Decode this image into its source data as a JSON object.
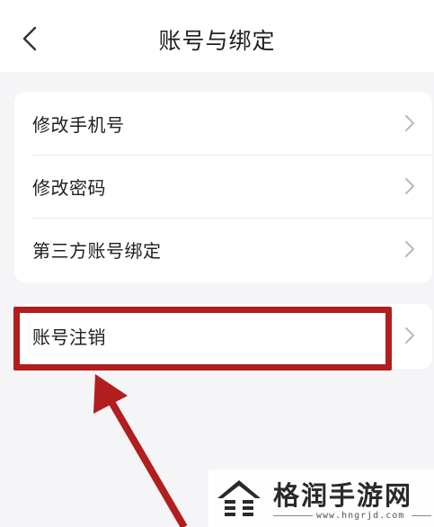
{
  "header": {
    "title": "账号与绑定",
    "back_icon": "chevron-left-icon"
  },
  "menu": {
    "group1": [
      {
        "label": "修改手机号"
      },
      {
        "label": "修改密码"
      },
      {
        "label": "第三方账号绑定"
      }
    ],
    "group2": [
      {
        "label": "账号注销"
      }
    ]
  },
  "annotation": {
    "highlight_color": "#b21e1e"
  },
  "watermark": {
    "text": "格润手游网",
    "url": "www.hngrjd.com"
  }
}
